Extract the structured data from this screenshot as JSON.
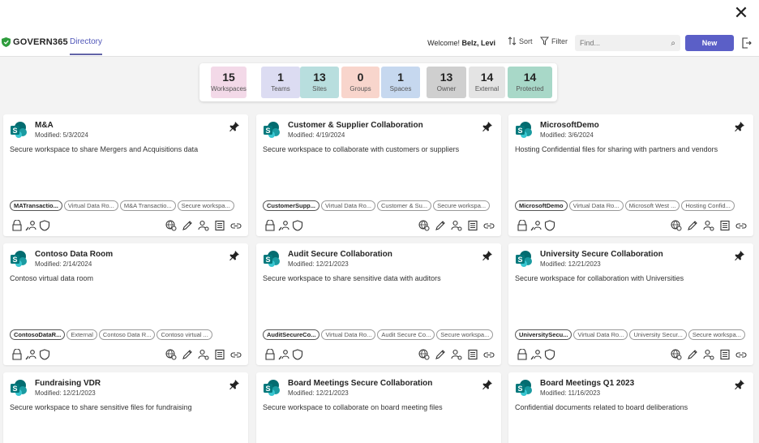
{
  "app": {
    "logo_text": "GOVERN365",
    "nav_tab": "Directory",
    "welcome_prefix": "Welcome!",
    "welcome_user": "Belz, Levi",
    "sort_label": "Sort",
    "filter_label": "Filter",
    "search_placeholder": "Find...",
    "new_label": "New"
  },
  "stats": [
    {
      "value": "15",
      "label": "Workspaces",
      "color": "#f3d9e8"
    },
    {
      "value": "1",
      "label": "Teams",
      "color": "#dcdcf2"
    },
    {
      "value": "13",
      "label": "Sites",
      "color": "#b8dede"
    },
    {
      "value": "0",
      "label": "Groups",
      "color": "#f8d5cc"
    },
    {
      "value": "1",
      "label": "Spaces",
      "color": "#c6d8ef"
    },
    {
      "value": "13",
      "label": "Owner",
      "color": "#cfcfcf"
    },
    {
      "value": "14",
      "label": "External",
      "color": "#e4e4e4"
    },
    {
      "value": "14",
      "label": "Protected",
      "color": "#a8d8c8"
    }
  ],
  "cards": [
    {
      "title": "M&A",
      "modified": "Modified: 5/3/2024",
      "desc": "Secure workspace to share Mergers and Acquisitions data",
      "tags": [
        "MATransactio...",
        "Virtual Data Ro...",
        "M&A Transactio...",
        "Secure workspa..."
      ]
    },
    {
      "title": "Customer & Supplier Collaboration",
      "modified": "Modified: 4/19/2024",
      "desc": "Secure workspace to collaborate with customers or suppliers",
      "tags": [
        "CustomerSupp...",
        "Virtual Data Ro...",
        "Customer & Su...",
        "Secure workspa..."
      ]
    },
    {
      "title": "MicrosoftDemo",
      "modified": "Modified: 3/6/2024",
      "desc": "Hosting Confidential files for sharing with partners and vendors",
      "tags": [
        "MicrosoftDemo",
        "Virtual Data Ro...",
        "Microsoft West ...",
        "Hosting Confid..."
      ]
    },
    {
      "title": "Contoso Data Room",
      "modified": "Modified: 2/14/2024",
      "desc": "Contoso virtual data room",
      "tags": [
        "ContosoDataR...",
        "External",
        "Contoso Data R...",
        "Contoso virtual ..."
      ]
    },
    {
      "title": "Audit Secure Collaboration",
      "modified": "Modified: 12/21/2023",
      "desc": "Secure workspace to share sensitive data with auditors",
      "tags": [
        "AuditSecureCo...",
        "Virtual Data Ro...",
        "Audit Secure Co...",
        "Secure workspa..."
      ]
    },
    {
      "title": "University Secure Collaboration",
      "modified": "Modified: 12/21/2023",
      "desc": "Secure workspace for collaboration with Universities",
      "tags": [
        "UniversitySecu...",
        "Virtual Data Ro...",
        "University Secur...",
        "Secure workspa..."
      ]
    },
    {
      "title": "Fundraising VDR",
      "modified": "Modified: 12/21/2023",
      "desc": "Secure workspace to share sensitive files for fundraising",
      "tags": []
    },
    {
      "title": "Board Meetings Secure Collaboration",
      "modified": "Modified: 12/21/2023",
      "desc": "Secure workspace to collaborate on board meeting files",
      "tags": []
    },
    {
      "title": "Board Meetings Q1 2023",
      "modified": "Modified: 11/16/2023",
      "desc": "Confidential documents related to board deliberations",
      "tags": []
    }
  ],
  "colors": {
    "accent": "#5b5fc7",
    "sharepoint": "#036c70",
    "brand": "#2f9d3d"
  }
}
